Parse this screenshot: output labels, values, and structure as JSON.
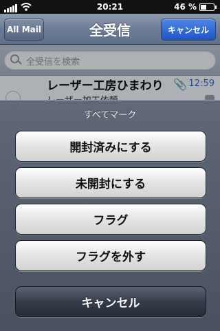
{
  "status_bar": {
    "time": "20:21",
    "battery": "46 %",
    "battery_level": 0.46,
    "signal_icon": "signal-bars-icon",
    "wifi_icon": "wifi-icon"
  },
  "nav": {
    "title": "全受信",
    "back_label": "All Mail",
    "cancel_label": "キャンセル"
  },
  "search": {
    "placeholder": "全受信を検索"
  },
  "mail": {
    "sender": "レーザー工房ひまわり",
    "subject": "レーザー加工依頼",
    "time": "12:59",
    "attachment_icon": "paperclip-icon"
  },
  "sheet": {
    "title": "すべてマーク",
    "buttons": [
      {
        "label": "開封済みにする"
      },
      {
        "label": "未開封にする"
      },
      {
        "label": "フラグ"
      },
      {
        "label": "フラグを外す"
      }
    ],
    "cancel_label": "キャンセル"
  },
  "colors": {
    "nav_accent": "#1e54c9",
    "time_blue": "#2f62c8"
  }
}
